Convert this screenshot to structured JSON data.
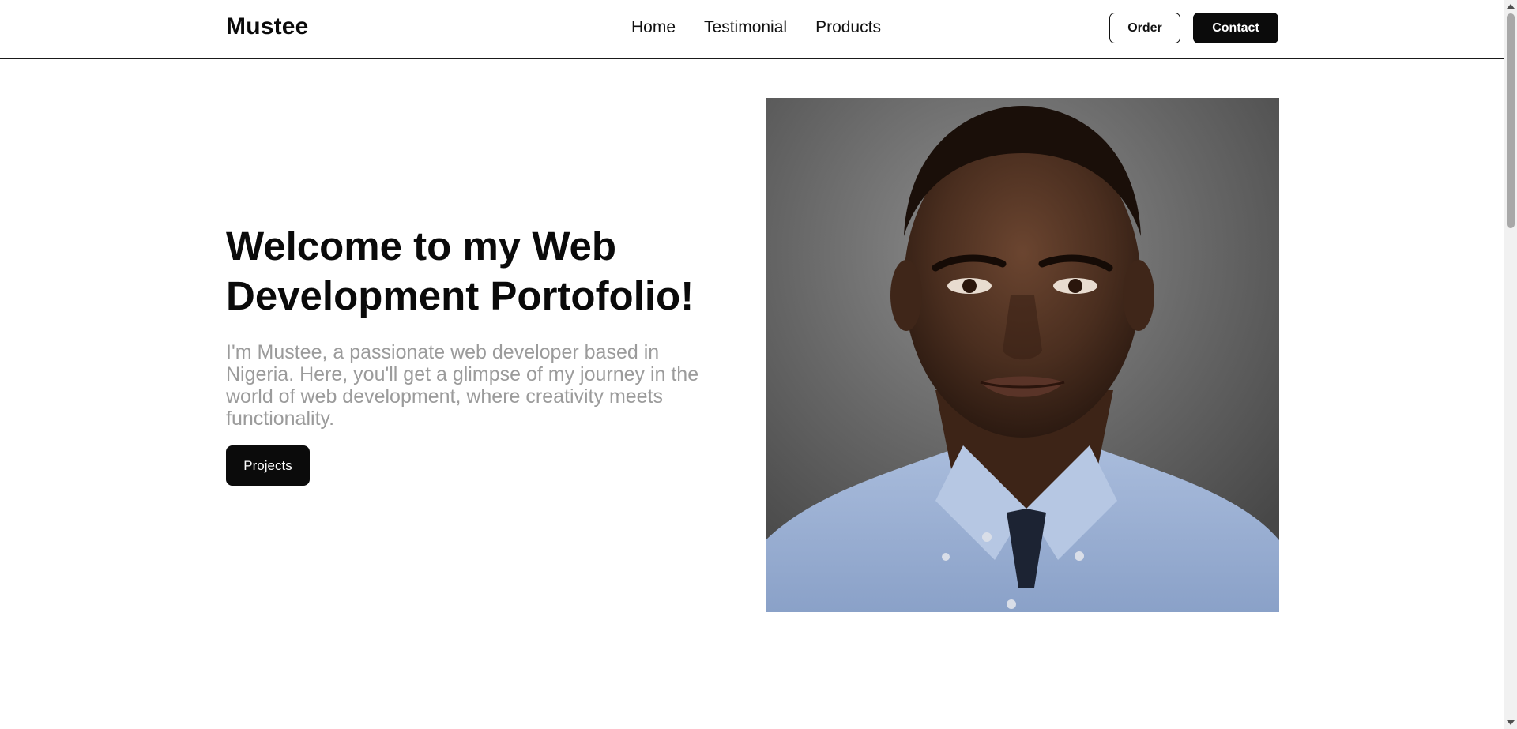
{
  "brand": {
    "name": "Mustee"
  },
  "nav": {
    "links": [
      {
        "label": "Home"
      },
      {
        "label": "Testimonial"
      },
      {
        "label": "Products"
      }
    ],
    "order_label": "Order",
    "contact_label": "Contact"
  },
  "hero": {
    "title": "Welcome to my Web Development Portofolio!",
    "description": "I'm Mustee, a passionate web developer based in Nigeria. Here, you'll get a glimpse of my journey in the world of web development, where creativity meets functionality.",
    "projects_label": "Projects"
  },
  "colors": {
    "primary": "#0b0b0b",
    "description_text": "#9b9b9b",
    "background": "#ffffff",
    "shirt": "#9fb3d6"
  }
}
